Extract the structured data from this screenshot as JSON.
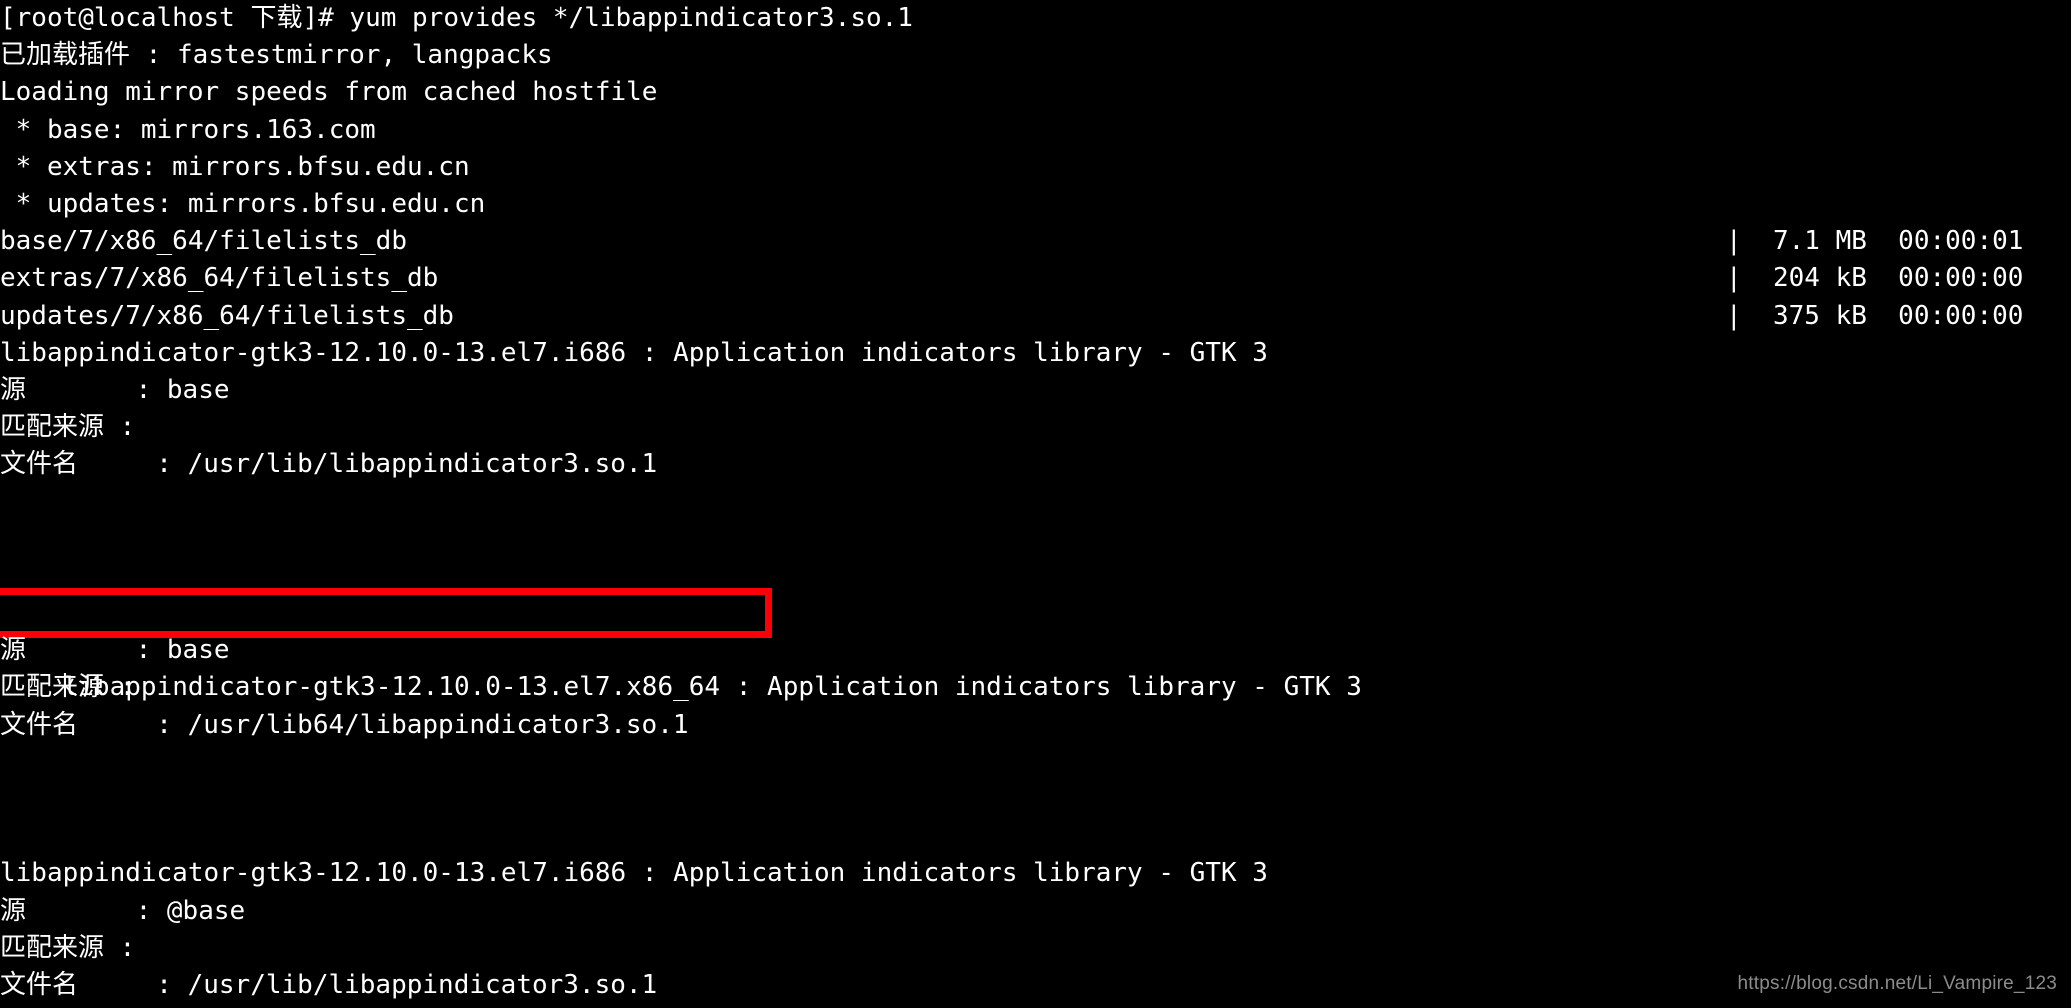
{
  "terminal": {
    "prompt_line": "[root@localhost 下载]# yum provides */libappindicator3.so.1",
    "plugins_line": "已加载插件 : fastestmirror, langpacks",
    "loading_line": "Loading mirror speeds from cached hostfile",
    "mirrors": [
      " * base: mirrors.163.com",
      " * extras: mirrors.bfsu.edu.cn",
      " * updates: mirrors.bfsu.edu.cn"
    ],
    "repo_progress": [
      {
        "name": "base/7/x86_64/filelists_db",
        "meta": "|  7.1 MB  00:00:01"
      },
      {
        "name": "extras/7/x86_64/filelists_db",
        "meta": "|  204 kB  00:00:00"
      },
      {
        "name": "updates/7/x86_64/filelists_db",
        "meta": "|  375 kB  00:00:00"
      }
    ],
    "packages": [
      {
        "header": "libappindicator-gtk3-12.10.0-13.el7.i686 : Application indicators library - GTK 3",
        "repo_label": "源",
        "repo_sep": "       : ",
        "repo_value": "base",
        "matched_label": "匹配来源 :",
        "file_label": "文件名",
        "file_sep": "     : ",
        "file_value": "/usr/lib/libappindicator3.so.1",
        "highlighted": false
      },
      {
        "header_highlight": "libappindicator-gtk3-12.10.0-13.el7.x86_64",
        "header_rest": " : Application indicators library - GTK 3",
        "repo_label": "源",
        "repo_sep": "       : ",
        "repo_value": "base",
        "matched_label": "匹配来源 :",
        "file_label": "文件名",
        "file_sep": "     : ",
        "file_value": "/usr/lib64/libappindicator3.so.1",
        "highlighted": true
      },
      {
        "header": "libappindicator-gtk3-12.10.0-13.el7.i686 : Application indicators library - GTK 3",
        "repo_label": "源",
        "repo_sep": "       : ",
        "repo_value": "@base",
        "matched_label": "匹配来源 :",
        "file_label": "文件名",
        "file_sep": "     : ",
        "file_value": "/usr/lib/libappindicator3.so.1",
        "highlighted": false
      }
    ],
    "watermark": "https://blog.csdn.net/Li_Vampire_123",
    "colors": {
      "background": "#000000",
      "foreground": "#ffffff",
      "highlight_box": "#fb0007",
      "watermark": "#8c8c8c"
    }
  }
}
